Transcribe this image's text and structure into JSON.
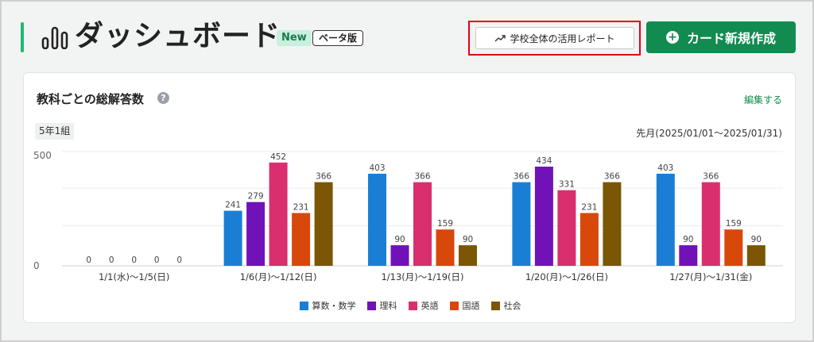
{
  "header": {
    "title": "ダッシュボード",
    "badge_new": "New",
    "badge_beta": "ベータ版",
    "report_button": "学校全体の活用レポート",
    "create_button": "カード新規作成",
    "icons": {
      "title": "bar-chart-icon",
      "report": "trend-up-icon",
      "create": "plus-circle-icon"
    }
  },
  "card": {
    "title": "教科ごとの総解答数",
    "edit_link": "編集する",
    "class_tag": "5年1組",
    "period": "先月(2025/01/01〜2025/01/31)"
  },
  "colors": {
    "accent": "#22b573",
    "primary": "#118b50",
    "highlight": "#e60012"
  },
  "chart_data": {
    "type": "bar",
    "categories": [
      "1/1(水)〜1/5(日)",
      "1/6(月)〜1/12(日)",
      "1/13(月)〜1/19(日)",
      "1/20(月)〜1/26(日)",
      "1/27(月)〜1/31(金)"
    ],
    "series": [
      {
        "name": "算数・数学",
        "color": "#1a7fd4",
        "values": [
          0,
          241,
          403,
          366,
          403
        ]
      },
      {
        "name": "理科",
        "color": "#7012b8",
        "values": [
          0,
          279,
          90,
          434,
          90
        ]
      },
      {
        "name": "英語",
        "color": "#d92f6f",
        "values": [
          0,
          452,
          366,
          331,
          366
        ]
      },
      {
        "name": "国語",
        "color": "#d8480b",
        "values": [
          0,
          231,
          159,
          231,
          159
        ]
      },
      {
        "name": "社会",
        "color": "#7a5605",
        "values": [
          0,
          366,
          90,
          366,
          90
        ]
      }
    ],
    "yticks": [
      "0",
      "500"
    ],
    "ylim": [
      0,
      500
    ],
    "grid": true,
    "legend": "bottom"
  }
}
